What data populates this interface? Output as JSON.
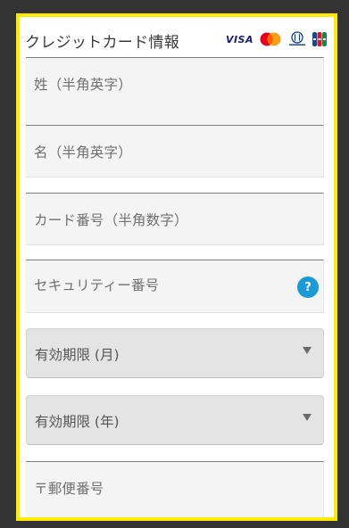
{
  "header": {
    "title": "クレジットカード情報",
    "card_brands": [
      {
        "name": "visa",
        "label": "VISA",
        "icon": "visa-icon"
      },
      {
        "name": "mastercard",
        "label": "MasterCard",
        "icon": "mastercard-icon"
      },
      {
        "name": "diners",
        "label": "Diners Club",
        "icon": "diners-icon"
      },
      {
        "name": "jcb",
        "label": "JCB",
        "icon": "jcb-icon"
      }
    ]
  },
  "form": {
    "last_name_placeholder": "姓（半角英字）",
    "first_name_placeholder": "名（半角英字）",
    "card_number_placeholder": "カード番号（半角数字）",
    "security_code_placeholder": "セキュリティー番号",
    "security_help_label": "?",
    "expiry_month_label": "有効期限 (月)",
    "expiry_year_label": "有効期限 (年)",
    "postal_code_placeholder": "〒郵便番号"
  },
  "colors": {
    "frame_border": "#ffeb00",
    "help_badge": "#1a9ad6",
    "page_background": "#333333"
  }
}
